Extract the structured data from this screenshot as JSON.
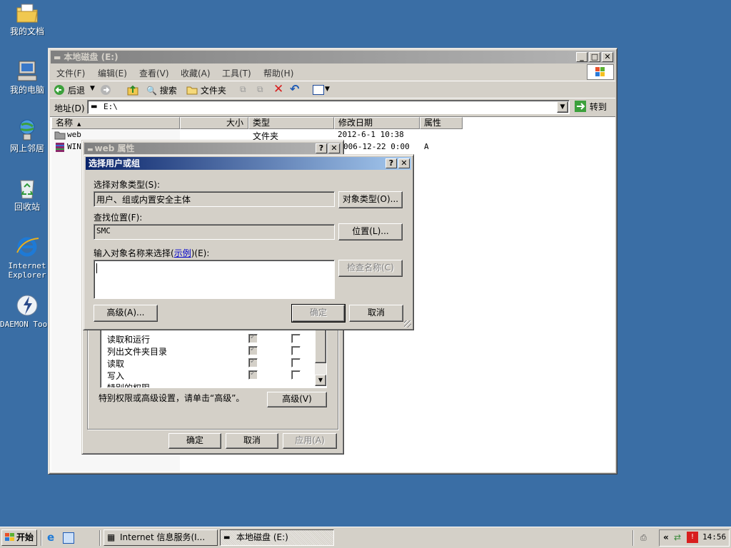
{
  "desktop": {
    "icons": [
      {
        "label": "我的文档",
        "icon": "folder-documents-icon"
      },
      {
        "label": "我的电脑",
        "icon": "computer-icon"
      },
      {
        "label": "网上邻居",
        "icon": "network-icon"
      },
      {
        "label": "回收站",
        "icon": "recycle-bin-icon"
      },
      {
        "label": "Internet Explorer",
        "icon": "ie-icon"
      },
      {
        "label": "DAEMON Tools",
        "icon": "daemon-tools-icon"
      }
    ]
  },
  "explorer": {
    "title": "本地磁盘 (E:)",
    "menu": [
      "文件(F)",
      "编辑(E)",
      "查看(V)",
      "收藏(A)",
      "工具(T)",
      "帮助(H)"
    ],
    "toolbar": {
      "back": "后退",
      "search": "搜索",
      "folders": "文件夹"
    },
    "address": {
      "label": "地址(D)",
      "value": "E:\\",
      "go": "转到"
    },
    "columns": [
      "名称",
      "大小",
      "类型",
      "修改日期",
      "属性"
    ],
    "files": [
      {
        "name": "web",
        "size": "",
        "type": "文件夹",
        "modified": "2012-6-1 10:38",
        "attr": ""
      },
      {
        "name": "WIN",
        "size": "",
        "type": "",
        "modified": "006-12-22 0:00",
        "attr": "A"
      }
    ]
  },
  "properties_dialog": {
    "title": "web 属性",
    "permissions": [
      "读取和运行",
      "列出文件夹目录",
      "读取",
      "写入",
      "特别的权限"
    ],
    "advanced_hint": "特别权限或高级设置，请单击“高级”。",
    "advanced_button": "高级(V)",
    "ok": "确定",
    "cancel": "取消",
    "apply": "应用(A)"
  },
  "select_dialog": {
    "title": "选择用户或组",
    "object_type_label": "选择对象类型(S):",
    "object_type_value": "用户、组或内置安全主体",
    "object_type_button": "对象类型(O)...",
    "location_label": "查找位置(F):",
    "location_value": "SMC",
    "location_button": "位置(L)...",
    "enter_label_pre": "输入对象名称来选择(",
    "enter_label_link": "示例",
    "enter_label_post": ")(E):",
    "input_value": "",
    "check_names": "检查名称(C)",
    "advanced": "高级(A)...",
    "ok": "确定",
    "cancel": "取消"
  },
  "taskbar": {
    "start": "开始",
    "tasks": [
      "Internet 信息服务(I...",
      "本地磁盘 (E:)"
    ],
    "clock": "14:56",
    "tray_chevron": "«"
  }
}
